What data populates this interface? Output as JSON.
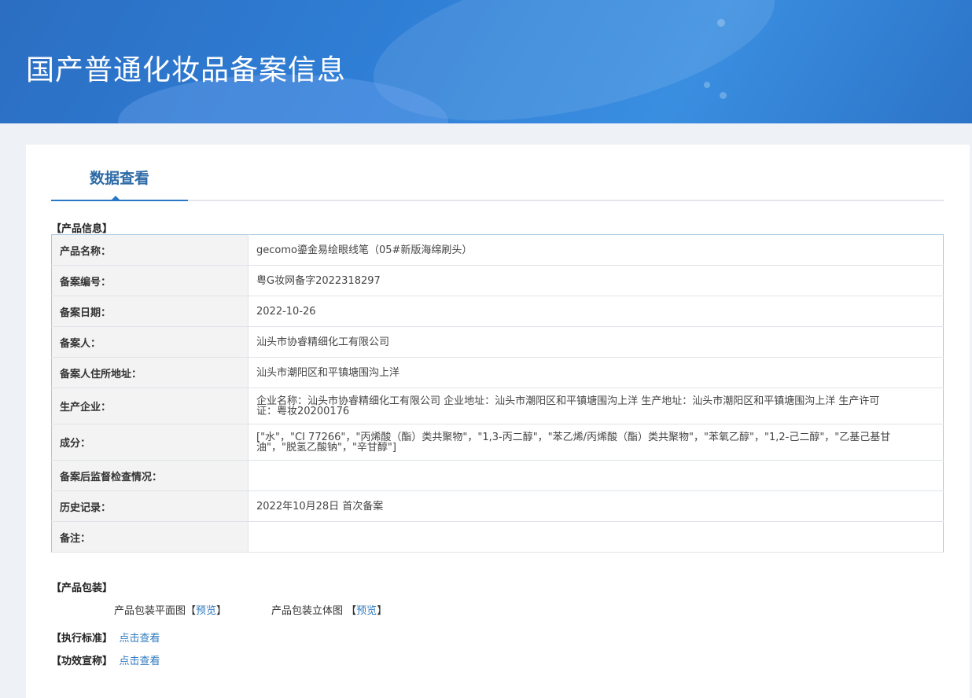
{
  "banner": {
    "title": "国产普通化妆品备案信息"
  },
  "tabs": [
    {
      "label": "数据查看",
      "active": true
    }
  ],
  "product_info": {
    "section_title": "【产品信息】",
    "rows": [
      {
        "label": "产品名称：",
        "value": "gecomo鎏金易绘眼线笔（05#新版海绵刷头）"
      },
      {
        "label": "备案编号：",
        "value": "粤G妆网备字2022318297"
      },
      {
        "label": "备案日期：",
        "value": "2022-10-26"
      },
      {
        "label": "备案人：",
        "value": "汕头市协睿精细化工有限公司"
      },
      {
        "label": "备案人住所地址：",
        "value": "汕头市潮阳区和平镇塘围沟上洋"
      },
      {
        "label": "生产企业：",
        "value": "企业名称：汕头市协睿精细化工有限公司 企业地址：汕头市潮阳区和平镇塘围沟上洋 生产地址：汕头市潮阳区和平镇塘围沟上洋 生产许可证：粤妆20200176"
      },
      {
        "label": "成分：",
        "value": "[\"水\"，\"CI 77266\"，\"丙烯酸（酯）类共聚物\"，\"1,3-丙二醇\"，\"苯乙烯/丙烯酸（酯）类共聚物\"，\"苯氧乙醇\"，\"1,2-己二醇\"，\"乙基己基甘油\"，\"脱氢乙酸钠\"，\"辛甘醇\"]"
      },
      {
        "label": "备案后监督检查情况：",
        "value": ""
      },
      {
        "label": "历史记录：",
        "value": "2022年10月28日 首次备案"
      },
      {
        "label": "备注：",
        "value": ""
      }
    ]
  },
  "packaging": {
    "section_title": "【产品包装】",
    "flat_label": "产品包装平面图",
    "stereo_label": "产品包装立体图",
    "preview_open": "【",
    "preview_text": "预览",
    "preview_close": "】"
  },
  "standard": {
    "section_title": "【执行标准】",
    "link": "点击查看"
  },
  "efficacy": {
    "section_title": "【功效宣称】",
    "link": "点击查看"
  }
}
